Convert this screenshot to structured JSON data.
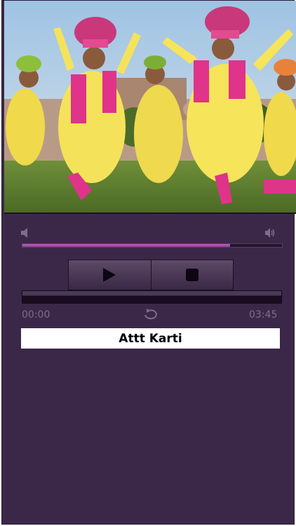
{
  "player": {
    "track_title": "Attt Karti",
    "elapsed_time": "00:00",
    "total_time": "03:45",
    "volume_fraction": 0.8,
    "progress_fraction": 0.0
  },
  "icons": {
    "volume_min": "speaker-low-icon",
    "volume_max": "speaker-high-icon",
    "play": "play-icon",
    "stop": "stop-icon",
    "repeat": "repeat-icon"
  },
  "colors": {
    "background": "#3b2848",
    "accent": "#a84cb0",
    "time_text": "#7d6d88"
  }
}
